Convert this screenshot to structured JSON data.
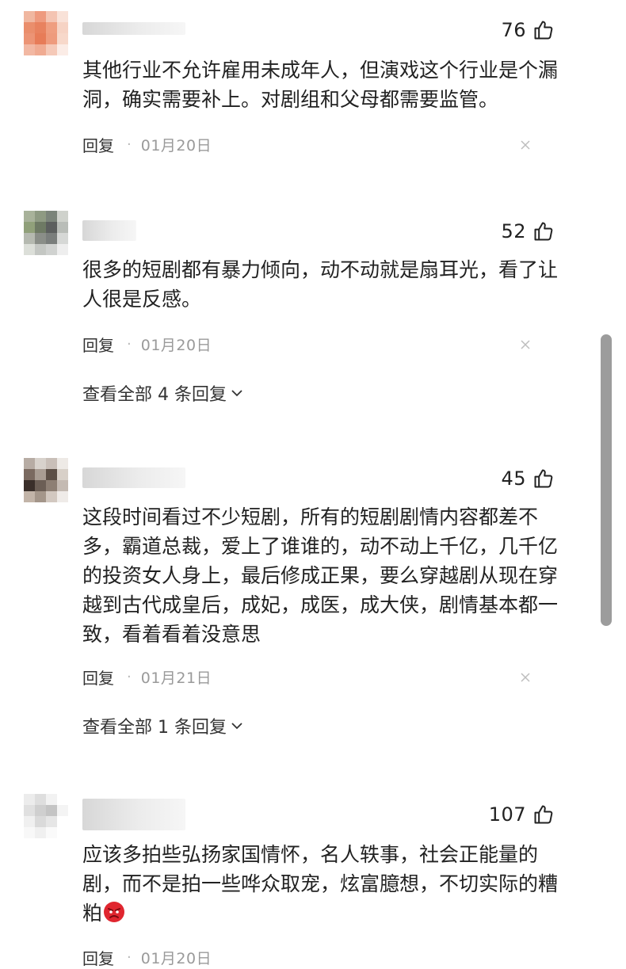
{
  "comments": [
    {
      "likes": "76",
      "text": "其他行业不允许雇用未成年人，但演戏这个行业是个漏洞，确实需要补上。对剧组和父母都需要监管。",
      "reply_label": "回复",
      "separator": "·",
      "date": "01月20日"
    },
    {
      "likes": "52",
      "text": "很多的短剧都有暴力倾向，动不动就是扇耳光，看了让人很是反感。",
      "reply_label": "回复",
      "separator": "·",
      "date": "01月20日",
      "view_all": "查看全部 4 条回复"
    },
    {
      "likes": "45",
      "text": "这段时间看过不少短剧，所有的短剧剧情内容都差不多，霸道总裁，爱上了谁谁的，动不动上千亿，几千亿的投资女人身上，最后修成正果，要么穿越剧从现在穿越到古代成皇后，成妃，成医，成大侠，剧情基本都一致，看着看着没意思",
      "reply_label": "回复",
      "separator": "·",
      "date": "01月21日",
      "view_all": "查看全部 1 条回复"
    },
    {
      "likes": "107",
      "text": "应该多拍些弘扬家国情怀，名人轶事，社会正能量的剧，而不是拍一些哗众取宠，炫富臆想，不切实际的糟粕",
      "emoji": "angry-face-icon",
      "reply_label": "回复",
      "separator": "·",
      "date": "01月20日"
    }
  ],
  "icons": {
    "like": "thumbs-up-icon",
    "close": "close-icon",
    "expand": "chevron-down-icon"
  },
  "colors": {
    "text": "#222222",
    "date": "#9a9a9a",
    "scrollbar": "#9c9c9c"
  }
}
